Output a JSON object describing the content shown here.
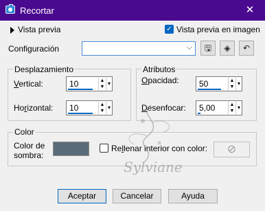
{
  "window": {
    "title": "Recortar",
    "close_glyph": "✕",
    "icon": "camera-icon"
  },
  "preview": {
    "label": "Vista previa",
    "checkbox_label": "Vista previa en imagen",
    "checked": true
  },
  "config": {
    "label": "Configuración",
    "value": "",
    "chevron": "⌵",
    "buttons": [
      {
        "icon": "save-icon",
        "glyph": "🖫"
      },
      {
        "icon": "cube-icon",
        "glyph": "◈"
      },
      {
        "icon": "reset-icon",
        "glyph": "↶"
      }
    ]
  },
  "displacement": {
    "title": "Desplazamiento",
    "vertical_label_first": "V",
    "vertical_label_rest": "ertical:",
    "vertical_value": "10",
    "horizontal_label_first": "Ho",
    "horizontal_label_u": "r",
    "horizontal_label_rest": "izontal:",
    "horizontal_value": "10"
  },
  "attributes": {
    "title": "Atributos",
    "opacity_label_first": "O",
    "opacity_label_rest": "pacidad:",
    "opacity_value": "50",
    "blur_label_first": "D",
    "blur_label_rest": "esenfocar:",
    "blur_value": "5,00"
  },
  "color": {
    "title": "Color",
    "shadow_label_line1": "Color de",
    "shadow_label_line2": "sombra:",
    "shadow_color": "#5a6b78",
    "fill_checkbox_label_first": "Re",
    "fill_checkbox_label_u": "l",
    "fill_checkbox_label_rest": "lenar interior con color:",
    "fill_checked": false,
    "fill_swatch_icon": "disabled-icon"
  },
  "watermark_text": "Sylviane",
  "buttons": {
    "ok": "Aceptar",
    "cancel": "Cancelar",
    "help": "Ayuda"
  },
  "colors": {
    "titlebar": "#4a0a8f",
    "accent": "#0067c0"
  }
}
